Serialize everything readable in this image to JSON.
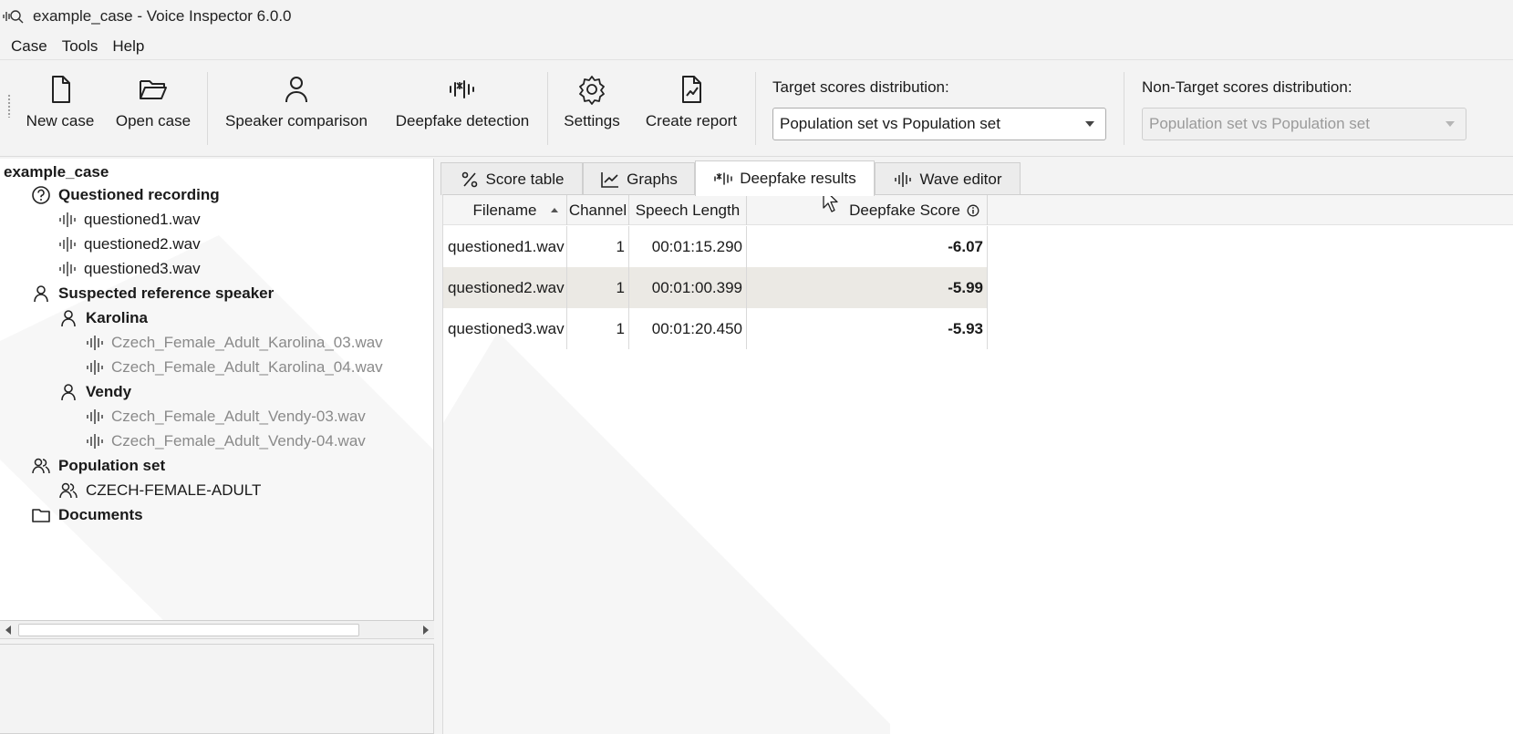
{
  "window": {
    "title": "example_case - Voice Inspector 6.0.0"
  },
  "menu": [
    "Case",
    "Tools",
    "Help"
  ],
  "toolbar": {
    "buttons": [
      {
        "label": "New case",
        "icon": "new-file-icon"
      },
      {
        "label": "Open case",
        "icon": "open-folder-icon"
      },
      {
        "label": "Speaker comparison",
        "icon": "person-icon"
      },
      {
        "label": "Deepfake detection",
        "icon": "deepfake-waveform-icon"
      },
      {
        "label": "Settings",
        "icon": "gear-icon"
      },
      {
        "label": "Create report",
        "icon": "report-icon"
      }
    ],
    "target_dist": {
      "label": "Target scores distribution:",
      "value": "Population set vs Population set"
    },
    "nontarget_dist": {
      "label": "Non-Target scores distribution:",
      "value": "Population set vs Population set"
    }
  },
  "tree": {
    "root": "example_case",
    "questioned": {
      "label": "Questioned recording",
      "files": [
        "questioned1.wav",
        "questioned2.wav",
        "questioned3.wav"
      ]
    },
    "reference": {
      "label": "Suspected reference speaker",
      "speakers": [
        {
          "name": "Karolina",
          "files": [
            "Czech_Female_Adult_Karolina_03.wav",
            "Czech_Female_Adult_Karolina_04.wav"
          ]
        },
        {
          "name": "Vendy",
          "files": [
            "Czech_Female_Adult_Vendy-03.wav",
            "Czech_Female_Adult_Vendy-04.wav"
          ]
        }
      ]
    },
    "population": {
      "label": "Population set",
      "child": "CZECH-FEMALE-ADULT"
    },
    "documents": "Documents"
  },
  "tabs": [
    {
      "label": "Score table",
      "icon": "percent-icon"
    },
    {
      "label": "Graphs",
      "icon": "graph-icon"
    },
    {
      "label": "Deepfake results",
      "icon": "deepfake-waveform-icon",
      "active": true
    },
    {
      "label": "Wave editor",
      "icon": "waveform-icon"
    }
  ],
  "table": {
    "headers": [
      "Filename",
      "Channel",
      "Speech Length",
      "Deepfake Score"
    ],
    "rows": [
      {
        "filename": "questioned1.wav",
        "channel": "1",
        "length": "00:01:15.290",
        "score": "-6.07"
      },
      {
        "filename": "questioned2.wav",
        "channel": "1",
        "length": "00:01:00.399",
        "score": "-5.99"
      },
      {
        "filename": "questioned3.wav",
        "channel": "1",
        "length": "00:01:20.450",
        "score": "-5.93"
      }
    ]
  }
}
